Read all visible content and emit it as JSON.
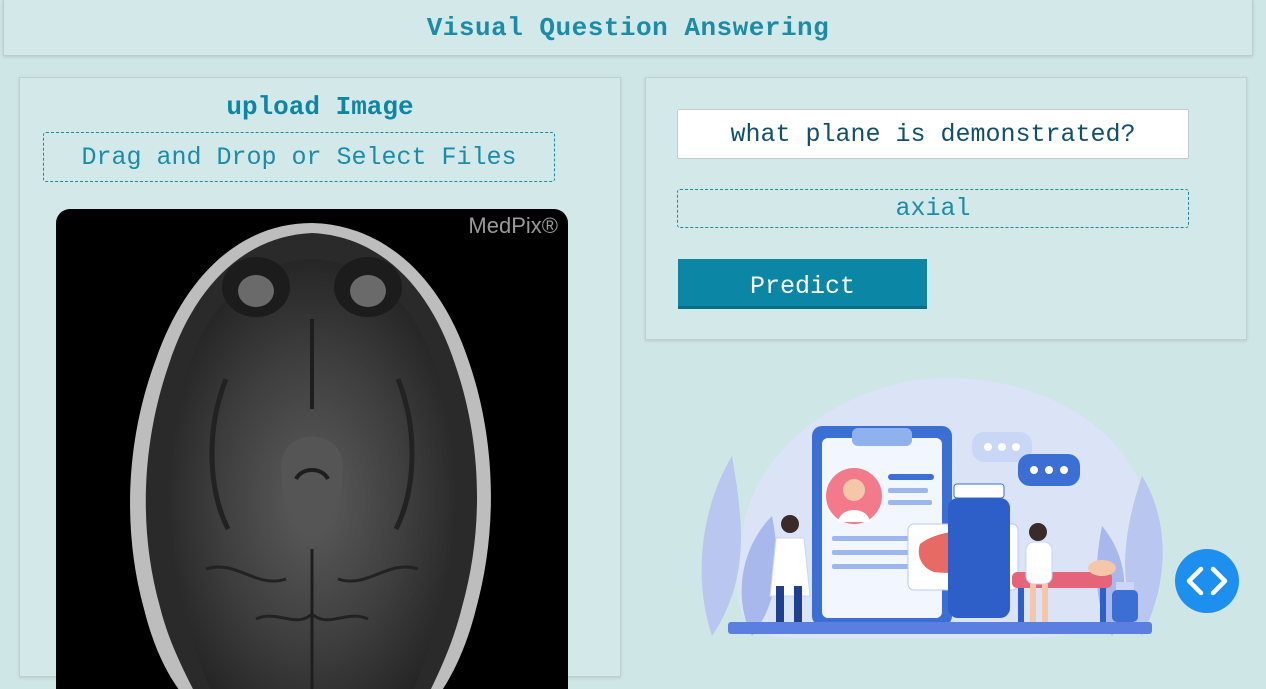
{
  "header": {
    "title": "Visual Question Answering"
  },
  "upload": {
    "title": "upload Image",
    "dropzone_label": "Drag and Drop or Select Files",
    "watermark": "MedPix®"
  },
  "question": {
    "value": "what plane is demonstrated?"
  },
  "answer": {
    "value": "axial"
  },
  "actions": {
    "predict_label": "Predict"
  },
  "colors": {
    "accent": "#1a8ca6",
    "button": "#0c86a5",
    "background": "#cfe6e6",
    "fab": "#1d8fef"
  },
  "icons": {
    "fab": "code-brackets-icon"
  }
}
